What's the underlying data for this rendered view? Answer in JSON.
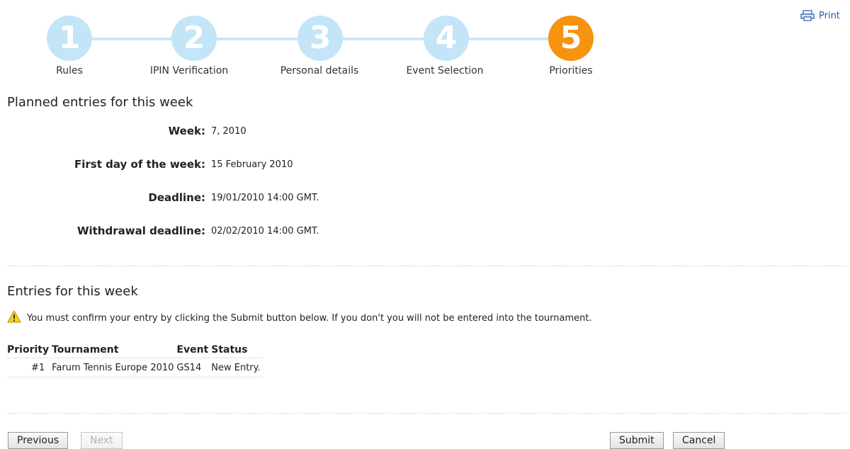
{
  "header": {
    "print_label": "Print",
    "print_icon": "printer-icon"
  },
  "steps": [
    {
      "number": "1",
      "label": "Rules",
      "state": "done"
    },
    {
      "number": "2",
      "label": "IPIN Verification",
      "state": "done"
    },
    {
      "number": "3",
      "label": "Personal details",
      "state": "done"
    },
    {
      "number": "4",
      "label": "Event Selection",
      "state": "done"
    },
    {
      "number": "5",
      "label": "Priorities",
      "state": "active"
    }
  ],
  "planned": {
    "title": "Planned entries for this week",
    "week_label": "Week:",
    "week_value": "7, 2010",
    "first_day_label": "First day of the week:",
    "first_day_value": "15 February 2010",
    "deadline_label": "Deadline:",
    "deadline_value": "19/01/2010 14:00 GMT.",
    "withdrawal_label": "Withdrawal deadline:",
    "withdrawal_value": "02/02/2010 14:00 GMT."
  },
  "entries": {
    "title": "Entries for this week",
    "warning_icon": "warning-icon",
    "warning_text": "You must confirm your entry by clicking the Submit button below. If you don't you will not be entered into the tournament.",
    "columns": [
      "Priority",
      "Tournament",
      "Event",
      "Status"
    ],
    "rows": [
      {
        "priority": "#1",
        "tournament": "Farum Tennis Europe 2010",
        "event": "GS14",
        "status": "New Entry."
      }
    ]
  },
  "buttons": {
    "previous": "Previous",
    "next": "Next",
    "submit": "Submit",
    "cancel": "Cancel"
  },
  "colors": {
    "step_inactive": "#c4e5f8",
    "step_active": "#f6930f",
    "link": "#1f5fa8"
  }
}
